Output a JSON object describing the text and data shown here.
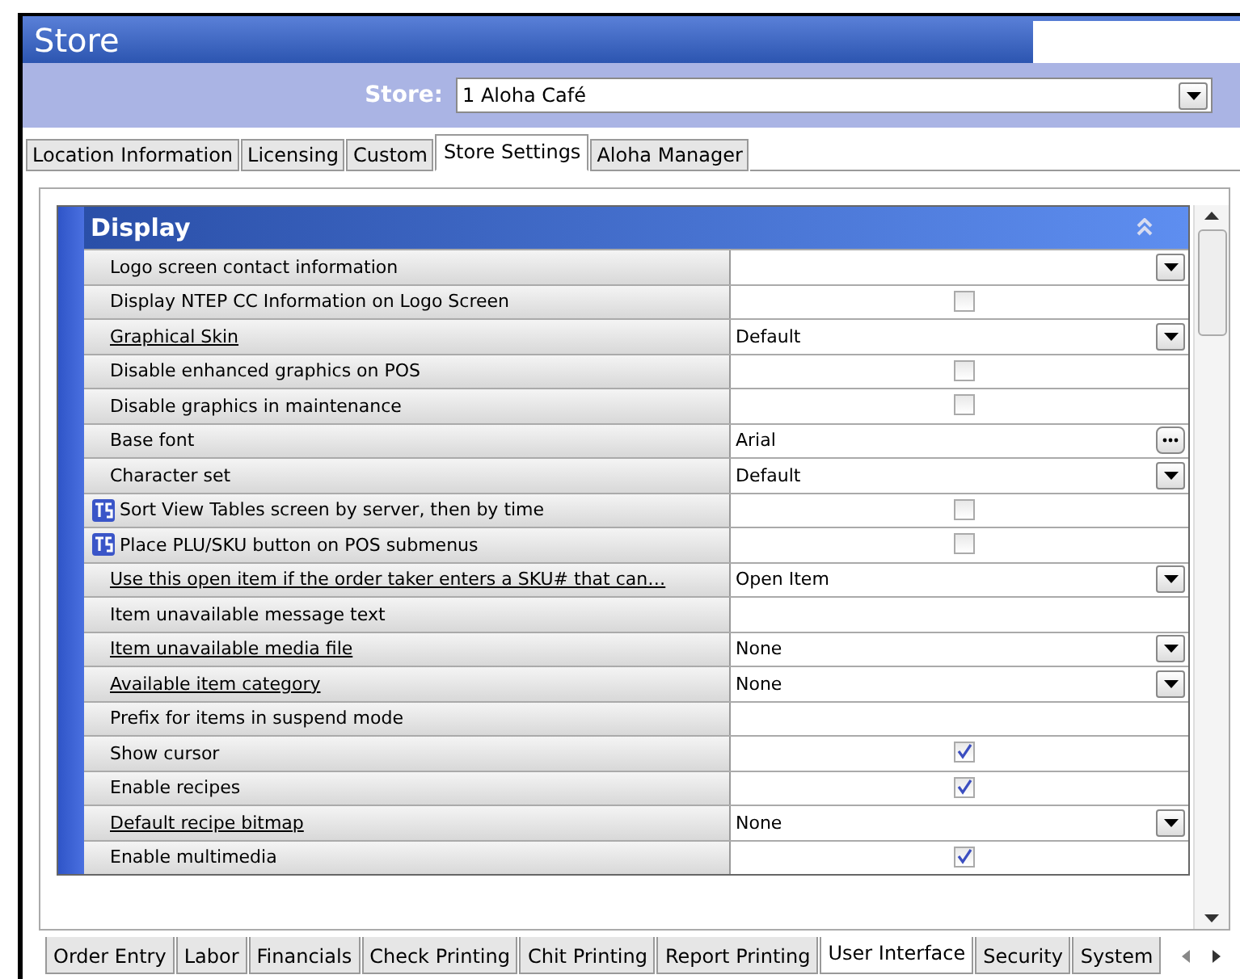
{
  "window": {
    "title": "Store"
  },
  "store": {
    "label": "Store:",
    "value": "1 Aloha Café"
  },
  "tabs": [
    {
      "label": "Location Information",
      "selected": false
    },
    {
      "label": "Licensing",
      "selected": false
    },
    {
      "label": "Custom",
      "selected": false
    },
    {
      "label": "Store Settings",
      "selected": true
    },
    {
      "label": "Aloha Manager",
      "selected": false
    }
  ],
  "section": {
    "title": "Display",
    "expanded": true
  },
  "rows": [
    {
      "label": "Logo screen contact information",
      "link": false,
      "ts": false,
      "kind": "dropdown",
      "value": ""
    },
    {
      "label": "Display NTEP CC Information on Logo Screen",
      "link": false,
      "ts": false,
      "kind": "checkbox",
      "checked": false
    },
    {
      "label": "Graphical Skin",
      "link": true,
      "ts": false,
      "kind": "dropdown",
      "value": "Default"
    },
    {
      "label": "Disable enhanced graphics on POS",
      "link": false,
      "ts": false,
      "kind": "checkbox",
      "checked": false
    },
    {
      "label": "Disable graphics in maintenance",
      "link": false,
      "ts": false,
      "kind": "checkbox",
      "checked": false
    },
    {
      "label": "Base font",
      "link": false,
      "ts": false,
      "kind": "browse",
      "value": "Arial"
    },
    {
      "label": "Character set",
      "link": false,
      "ts": false,
      "kind": "dropdown",
      "value": "Default"
    },
    {
      "label": "Sort View Tables screen by server, then by time",
      "link": false,
      "ts": true,
      "kind": "checkbox",
      "checked": false
    },
    {
      "label": "Place PLU/SKU button on POS submenus",
      "link": false,
      "ts": true,
      "kind": "checkbox",
      "checked": false
    },
    {
      "label": "Use this open item if the order taker enters a SKU# that can…",
      "link": true,
      "ts": false,
      "kind": "dropdown",
      "value": "Open Item"
    },
    {
      "label": "Item unavailable message text",
      "link": false,
      "ts": false,
      "kind": "text",
      "value": ""
    },
    {
      "label": "Item unavailable media file",
      "link": true,
      "ts": false,
      "kind": "dropdown",
      "value": "None"
    },
    {
      "label": "Available item category",
      "link": true,
      "ts": false,
      "kind": "dropdown",
      "value": "None"
    },
    {
      "label": "Prefix for items in suspend mode",
      "link": false,
      "ts": false,
      "kind": "text",
      "value": ""
    },
    {
      "label": "Show cursor",
      "link": false,
      "ts": false,
      "kind": "checkbox",
      "checked": true
    },
    {
      "label": "Enable recipes",
      "link": false,
      "ts": false,
      "kind": "checkbox",
      "checked": true
    },
    {
      "label": "Default recipe bitmap",
      "link": true,
      "ts": false,
      "kind": "dropdown",
      "value": "None"
    },
    {
      "label": "Enable multimedia",
      "link": false,
      "ts": false,
      "kind": "checkbox",
      "checked": true
    }
  ],
  "bottom_tabs": [
    {
      "label": "Order Entry",
      "selected": false
    },
    {
      "label": "Labor",
      "selected": false
    },
    {
      "label": "Financials",
      "selected": false
    },
    {
      "label": "Check Printing",
      "selected": false
    },
    {
      "label": "Chit Printing",
      "selected": false
    },
    {
      "label": "Report Printing",
      "selected": false
    },
    {
      "label": "User Interface",
      "selected": true
    },
    {
      "label": "Security",
      "selected": false
    },
    {
      "label": "System",
      "selected": false
    }
  ]
}
